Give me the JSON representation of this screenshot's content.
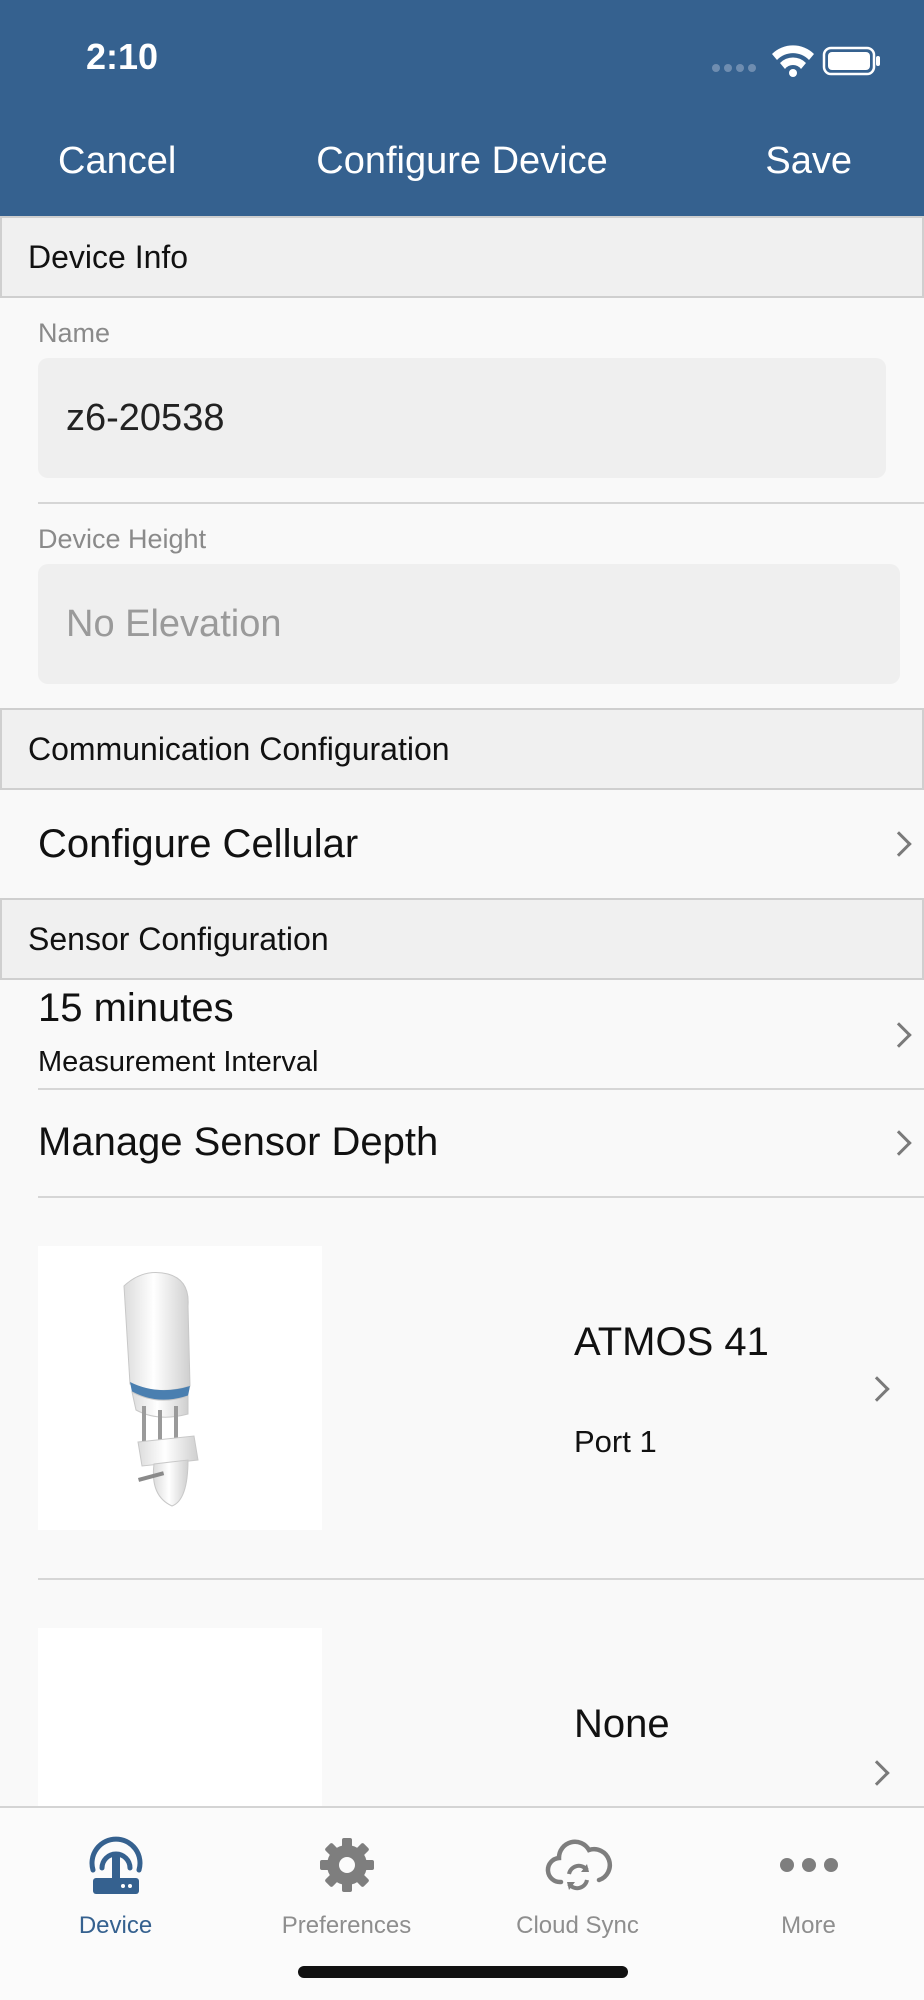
{
  "status_bar": {
    "time": "2:10"
  },
  "nav": {
    "cancel_label": "Cancel",
    "title": "Configure Device",
    "save_label": "Save"
  },
  "device_info": {
    "section_title": "Device Info",
    "name_label": "Name",
    "name_value": "z6-20538",
    "height_label": "Device Height",
    "height_placeholder": "No Elevation"
  },
  "communication": {
    "section_title": "Communication Configuration",
    "configure_cellular": "Configure Cellular"
  },
  "sensor_config": {
    "section_title": "Sensor Configuration",
    "interval_value": "15 minutes",
    "interval_label": "Measurement Interval",
    "manage_depth": "Manage Sensor Depth",
    "sensors": [
      {
        "name": "ATMOS 41",
        "port": "Port 1"
      },
      {
        "name": "None"
      }
    ]
  },
  "tabbar": {
    "tabs": [
      {
        "label": "Device",
        "icon": "device-icon",
        "active": true
      },
      {
        "label": "Preferences",
        "icon": "gear-icon"
      },
      {
        "label": "Cloud Sync",
        "icon": "cloud-sync-icon"
      },
      {
        "label": "More",
        "icon": "more-icon"
      }
    ]
  },
  "colors": {
    "header": "#35618f",
    "active_tab": "#35618f",
    "inactive_tab": "#8e8e8e"
  }
}
